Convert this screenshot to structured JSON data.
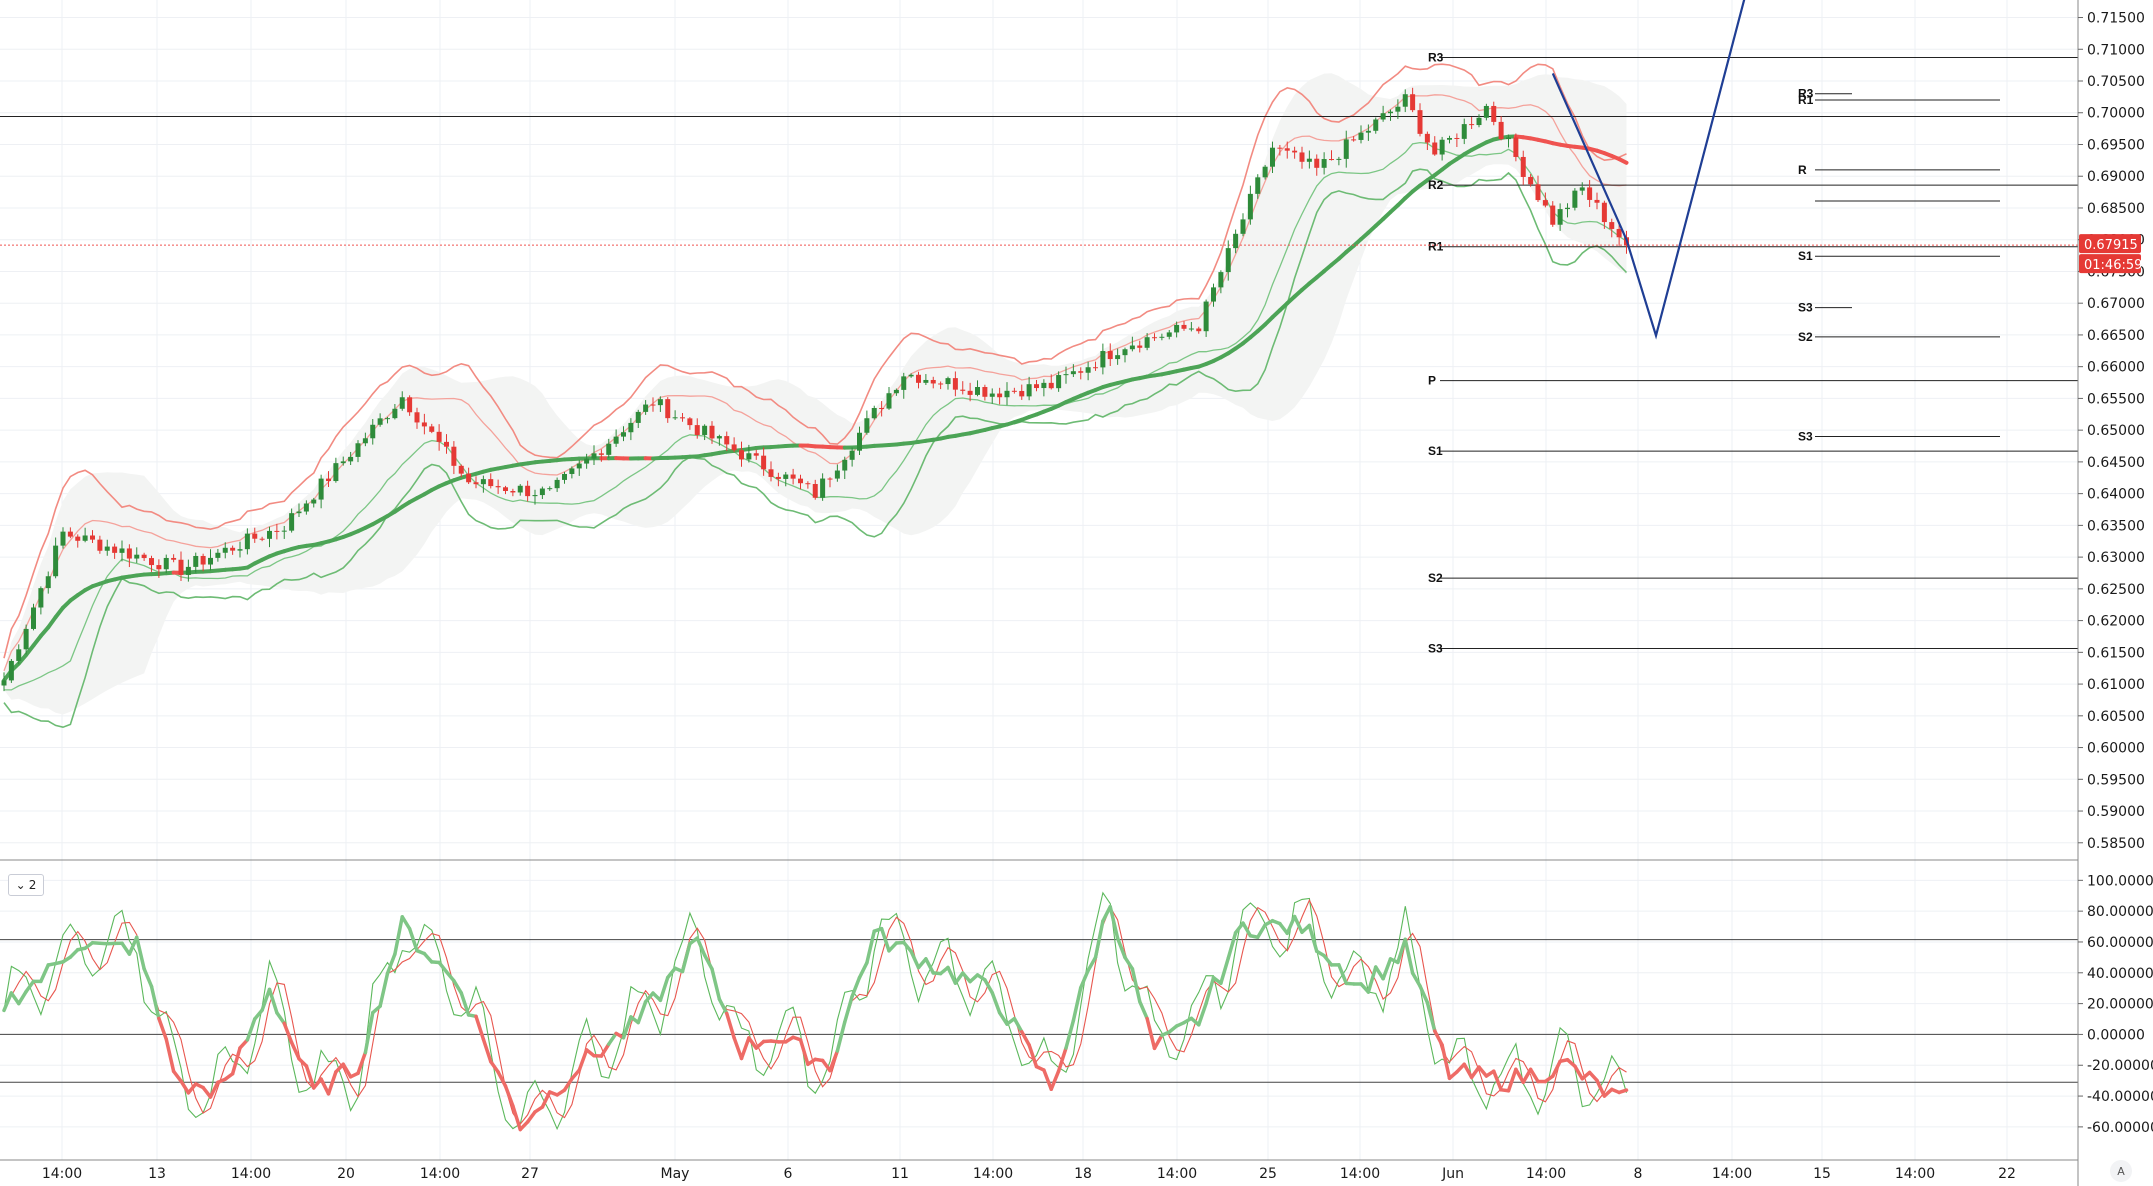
{
  "chart_data": [
    {
      "type": "candlestick",
      "panel": "price",
      "y_ticks": [
        "0.71500",
        "0.71000",
        "0.70500",
        "0.70000",
        "0.69500",
        "0.69000",
        "0.68500",
        "0.68000",
        "0.67500",
        "0.67000",
        "0.66500",
        "0.66000",
        "0.65500",
        "0.65000",
        "0.64500",
        "0.64000",
        "0.63500",
        "0.63000",
        "0.62500",
        "0.62000",
        "0.61500",
        "0.61000",
        "0.60500",
        "0.60000",
        "0.59500",
        "0.59000",
        "0.58500"
      ],
      "ylim": [
        0.5815,
        0.7165
      ],
      "x_ticks": [
        "14:00",
        "13",
        "14:00",
        "20",
        "14:00",
        "27",
        "May",
        "6",
        "11",
        "14:00",
        "18",
        "14:00",
        "25",
        "14:00",
        "Jun",
        "14:00",
        "8",
        "14:00",
        "15",
        "14:00",
        "22"
      ],
      "key_anchors": [
        {
          "x": 0,
          "close": 0.6106
        },
        {
          "x": 8,
          "close": 0.6338
        },
        {
          "x": 24,
          "close": 0.6281
        },
        {
          "x": 38,
          "close": 0.635
        },
        {
          "x": 54,
          "close": 0.6553
        },
        {
          "x": 63,
          "close": 0.6418
        },
        {
          "x": 74,
          "close": 0.64
        },
        {
          "x": 88,
          "close": 0.6545
        },
        {
          "x": 96,
          "close": 0.6488
        },
        {
          "x": 110,
          "close": 0.64
        },
        {
          "x": 122,
          "close": 0.659
        },
        {
          "x": 134,
          "close": 0.656
        },
        {
          "x": 142,
          "close": 0.657
        },
        {
          "x": 152,
          "close": 0.6635
        },
        {
          "x": 162,
          "close": 0.6665
        },
        {
          "x": 172,
          "close": 0.6945
        },
        {
          "x": 178,
          "close": 0.691
        },
        {
          "x": 190,
          "close": 0.702
        },
        {
          "x": 194,
          "close": 0.6935
        },
        {
          "x": 201,
          "close": 0.701
        },
        {
          "x": 210,
          "close": 0.683
        },
        {
          "x": 214,
          "close": 0.688
        },
        {
          "x": 220,
          "close": 0.6791
        }
      ],
      "last_price": "0.67915",
      "countdown": "01:46:59",
      "hline_main": 0.6994,
      "pivot_levels_left": [
        {
          "label": "R3",
          "value": 0.7087
        },
        {
          "label": "R2",
          "value": 0.6886
        },
        {
          "label": "R1",
          "value": 0.6789
        },
        {
          "label": "P",
          "value": 0.6578
        },
        {
          "label": "S1",
          "value": 0.6467
        },
        {
          "label": "S2",
          "value": 0.6267
        },
        {
          "label": "S3",
          "value": 0.6156
        }
      ],
      "pivot_levels_right": [
        {
          "label": "R3",
          "value": 0.703
        },
        {
          "label": "R1",
          "value": 0.702
        },
        {
          "label": "R",
          "value": 0.691
        },
        {
          "label": "",
          "value": 0.6861
        },
        {
          "label": "S1",
          "value": 0.6774
        },
        {
          "label": "S3",
          "value": 0.6693
        },
        {
          "label": "S2",
          "value": 0.6647
        },
        {
          "label": "S3",
          "value": 0.649
        }
      ],
      "projection_path": [
        {
          "x": 210,
          "y": 0.7062
        },
        {
          "x": 220,
          "y": 0.68
        },
        {
          "x": 224,
          "y": 0.6649
        },
        {
          "x": 236,
          "y": 0.718
        }
      ]
    },
    {
      "type": "line",
      "panel": "oscillator",
      "indicator_badge": "2",
      "y_ticks": [
        "100.00000",
        "80.00000",
        "60.00000",
        "40.00000",
        "20.00000",
        "0.00000",
        "-20.00000",
        "-40.00000",
        "-60.00000"
      ],
      "ylim": [
        -75,
        108
      ],
      "levels": [
        61.5,
        0,
        -31
      ],
      "anchors": [
        {
          "x": 0,
          "value": 20
        },
        {
          "x": 6,
          "value": 40
        },
        {
          "x": 10,
          "value": 60
        },
        {
          "x": 14,
          "value": 55
        },
        {
          "x": 18,
          "value": 58
        },
        {
          "x": 24,
          "value": -35
        },
        {
          "x": 30,
          "value": -35
        },
        {
          "x": 36,
          "value": 30
        },
        {
          "x": 42,
          "value": -38
        },
        {
          "x": 48,
          "value": -20
        },
        {
          "x": 54,
          "value": 70
        },
        {
          "x": 62,
          "value": 30
        },
        {
          "x": 70,
          "value": -58
        },
        {
          "x": 78,
          "value": -20
        },
        {
          "x": 86,
          "value": 8
        },
        {
          "x": 94,
          "value": 60
        },
        {
          "x": 100,
          "value": -10
        },
        {
          "x": 104,
          "value": 0
        },
        {
          "x": 112,
          "value": -20
        },
        {
          "x": 118,
          "value": 65
        },
        {
          "x": 126,
          "value": 45
        },
        {
          "x": 134,
          "value": 28
        },
        {
          "x": 142,
          "value": -35
        },
        {
          "x": 150,
          "value": 85
        },
        {
          "x": 156,
          "value": -10
        },
        {
          "x": 162,
          "value": 10
        },
        {
          "x": 168,
          "value": 70
        },
        {
          "x": 176,
          "value": 70
        },
        {
          "x": 184,
          "value": 30
        },
        {
          "x": 190,
          "value": 55
        },
        {
          "x": 196,
          "value": -25
        },
        {
          "x": 204,
          "value": -30
        },
        {
          "x": 212,
          "value": -20
        },
        {
          "x": 218,
          "value": -40
        },
        {
          "x": 220,
          "value": -42
        }
      ]
    }
  ]
}
